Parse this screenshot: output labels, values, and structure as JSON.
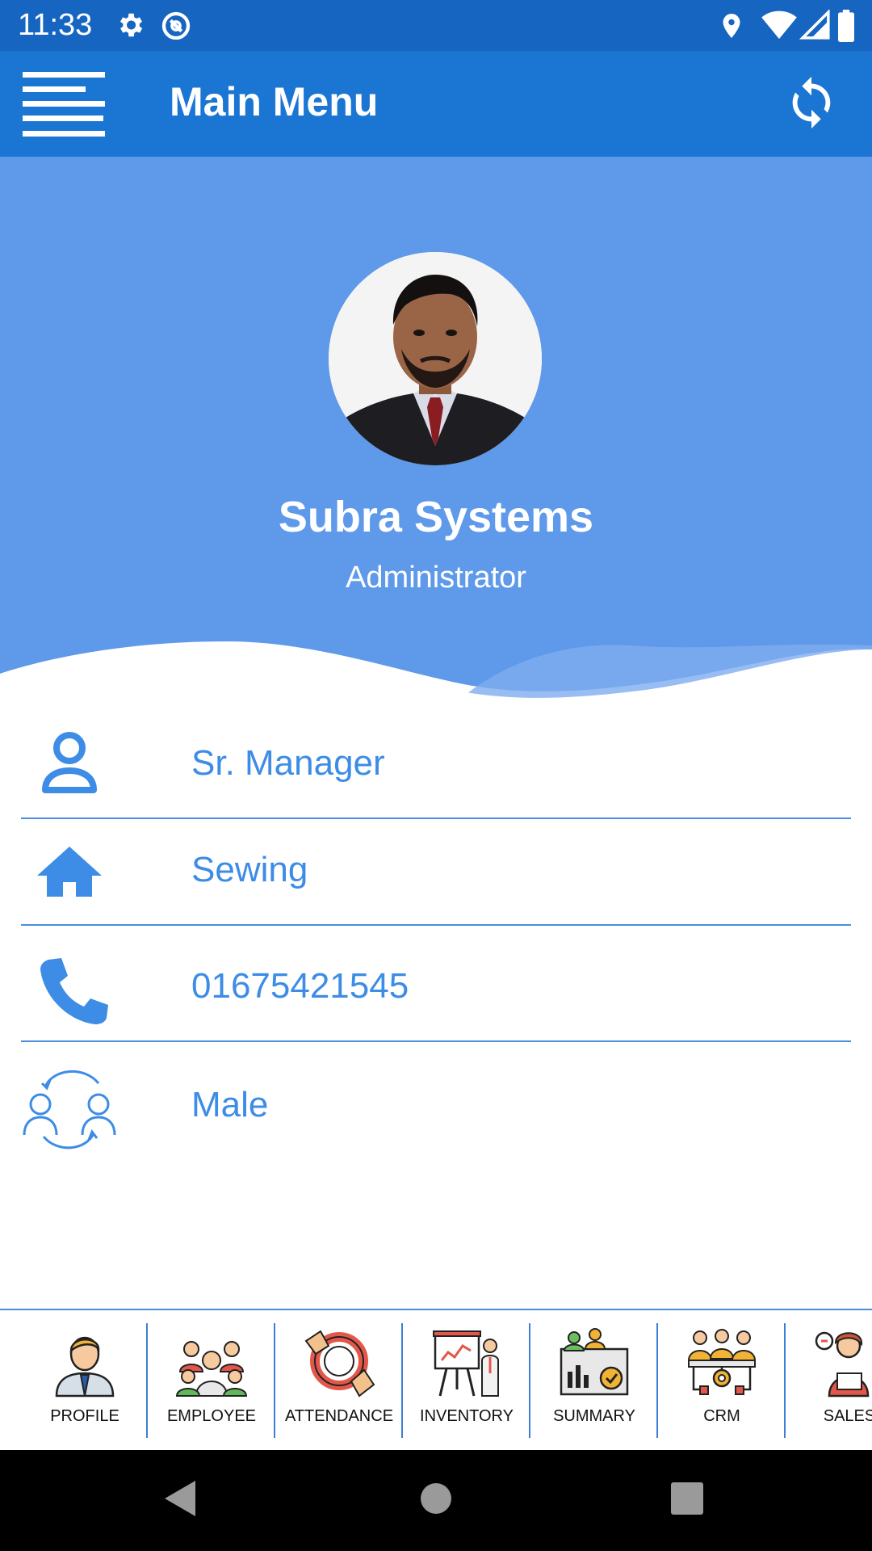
{
  "status_bar": {
    "time": "11:33",
    "icons": [
      "settings-icon",
      "sync-status-icon",
      "location-icon",
      "wifi-icon",
      "signal-icon",
      "battery-icon"
    ]
  },
  "app_bar": {
    "title": "Main Menu",
    "menu_icon": "hamburger-menu-icon",
    "refresh_icon": "refresh-icon"
  },
  "profile": {
    "name": "Subra Systems",
    "role": "Administrator"
  },
  "info": [
    {
      "icon": "person-icon",
      "value": "Sr. Manager"
    },
    {
      "icon": "home-icon",
      "value": "Sewing"
    },
    {
      "icon": "phone-icon",
      "value": "01675421545"
    },
    {
      "icon": "gender-icon",
      "value": "Male"
    }
  ],
  "bottom_nav": [
    {
      "label": "PROFILE",
      "icon": "profile-icon"
    },
    {
      "label": "EMPLOYEE",
      "icon": "employee-icon"
    },
    {
      "label": "ATTENDANCE",
      "icon": "attendance-icon"
    },
    {
      "label": "INVENTORY",
      "icon": "inventory-icon"
    },
    {
      "label": "SUMMARY",
      "icon": "summary-icon"
    },
    {
      "label": "CRM",
      "icon": "crm-icon"
    },
    {
      "label": "SALES",
      "icon": "sales-icon"
    }
  ],
  "colors": {
    "status_bar": "#1665c1",
    "app_bar": "#1a76d2",
    "header": "#5e99ea",
    "accent_text": "#3d8ce6",
    "divider": "#4a8ee0",
    "system_nav": "#000000"
  }
}
